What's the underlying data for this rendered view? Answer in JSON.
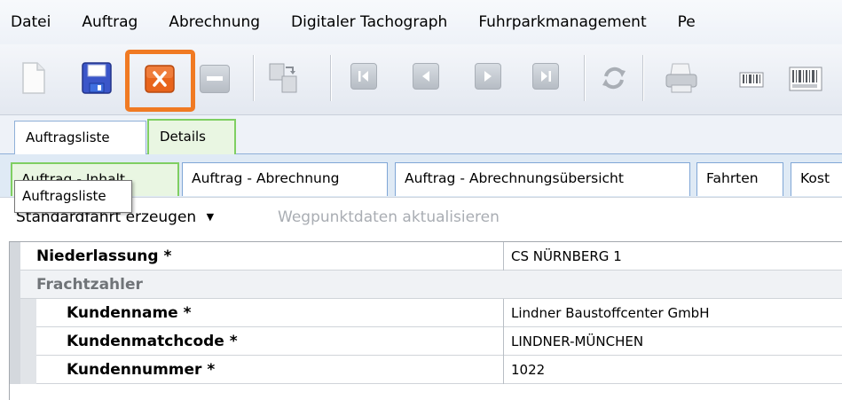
{
  "menu": [
    "Datei",
    "Auftrag",
    "Abrechnung",
    "Digitaler Tachograph",
    "Fuhrparkmanagement",
    "Pe"
  ],
  "toolbar": {
    "icons": [
      "new-document",
      "save",
      "close-x",
      "minus",
      "copy-transfer",
      "first",
      "previous",
      "next",
      "last",
      "refresh",
      "print",
      "barcode-small",
      "barcode-large"
    ],
    "accent_highlight": "#f07a23"
  },
  "tabs_top": [
    {
      "label": "Auftragsliste",
      "active": false
    },
    {
      "label": "Details",
      "active": true
    }
  ],
  "tabs_sub": [
    {
      "label": "Auftrag - Inhalt",
      "active": true
    },
    {
      "label": "Auftrag - Abrechnung",
      "active": false
    },
    {
      "label": "Auftrag - Abrechnungsübersicht",
      "active": false
    },
    {
      "label": "Fahrten",
      "active": false
    },
    {
      "label": "Kost",
      "active": false
    }
  ],
  "actions": {
    "standard_label": "Standardfahrt erzeugen",
    "waypoints_label": "Wegpunktdaten aktualisieren"
  },
  "tooltip": "Auftragsliste",
  "grid": {
    "rows": [
      {
        "label": "Niederlassung *",
        "value": "CS NÜRNBERG 1",
        "type": "field"
      },
      {
        "label": "Frachtzahler",
        "value": "",
        "type": "category"
      },
      {
        "label": "Kundenname *",
        "value": "Lindner Baustoffcenter GmbH",
        "type": "subfield"
      },
      {
        "label": "Kundenmatchcode *",
        "value": "LINDNER-MÜNCHEN",
        "type": "subfield"
      },
      {
        "label": "Kundennummer *",
        "value": "1022",
        "type": "subfield"
      }
    ]
  }
}
